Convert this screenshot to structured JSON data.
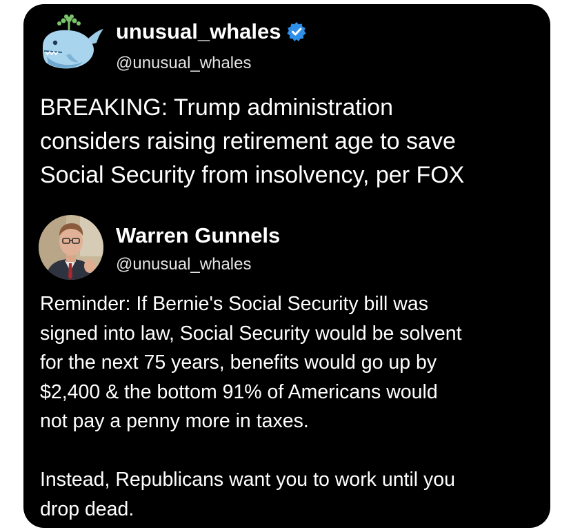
{
  "tweet": {
    "display_name": "unusual_whales",
    "handle": "@unusual_whales",
    "verified": true,
    "avatar_icon": "whale-icon",
    "text": "BREAKING: Trump administration\nconsiders raising retirement age to save\nSocial Security from insolvency, per FOX"
  },
  "quoted": {
    "display_name": "Warren Gunnels",
    "handle": "@unusual_whales",
    "avatar_icon": "profile-photo",
    "text": "Reminder: If Bernie's Social Security bill was\nsigned into law, Social Security would be solvent\nfor the next 75 years, benefits would go up by\n$2,400 & the bottom 91% of Americans would\nnot pay a penny more in taxes.\n\nInstead, Republicans want you to work until you\ndrop dead."
  },
  "colors": {
    "background": "#000000",
    "text": "#ffffff",
    "verified_badge": "#2f8fe8",
    "whale": "#a9d4ee"
  }
}
